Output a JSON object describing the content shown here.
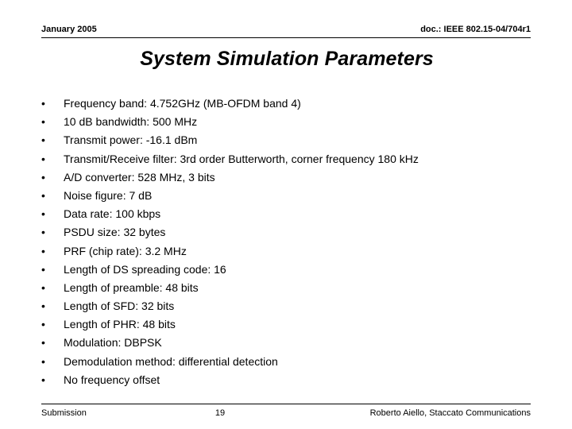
{
  "header": {
    "date": "January 2005",
    "doc_reference": "doc.: IEEE 802.15-04/704r1"
  },
  "title": "System Simulation Parameters",
  "bullet_marker": "•",
  "bullets": [
    {
      "text": "Frequency band: 4.752GHz (MB-OFDM band 4)"
    },
    {
      "text": "10 dB bandwidth: 500 MHz"
    },
    {
      "text": "Transmit power: -16.1 dBm"
    },
    {
      "text": "Transmit/Receive filter: 3rd order Butterworth, corner frequency 180 kHz"
    },
    {
      "text": "A/D converter: 528 MHz, 3 bits"
    },
    {
      "text": "Noise figure: 7 dB"
    },
    {
      "text": "Data rate: 100 kbps"
    },
    {
      "text": "PSDU size: 32 bytes"
    },
    {
      "text": "PRF (chip rate): 3.2 MHz"
    },
    {
      "text": "Length of DS spreading code: 16"
    },
    {
      "text": "Length of preamble: 48 bits"
    },
    {
      "text": "Length of SFD: 32 bits"
    },
    {
      "text": "Length of PHR: 48 bits"
    },
    {
      "text": "Modulation: DBPSK"
    },
    {
      "text": "Demodulation method: differential detection"
    },
    {
      "text": "No frequency offset"
    }
  ],
  "footer": {
    "left": "Submission",
    "page_number": "19",
    "right": "Roberto Aiello, Staccato Communications"
  },
  "colors": {
    "text": "#000000",
    "background": "#ffffff",
    "rule": "#000000"
  }
}
